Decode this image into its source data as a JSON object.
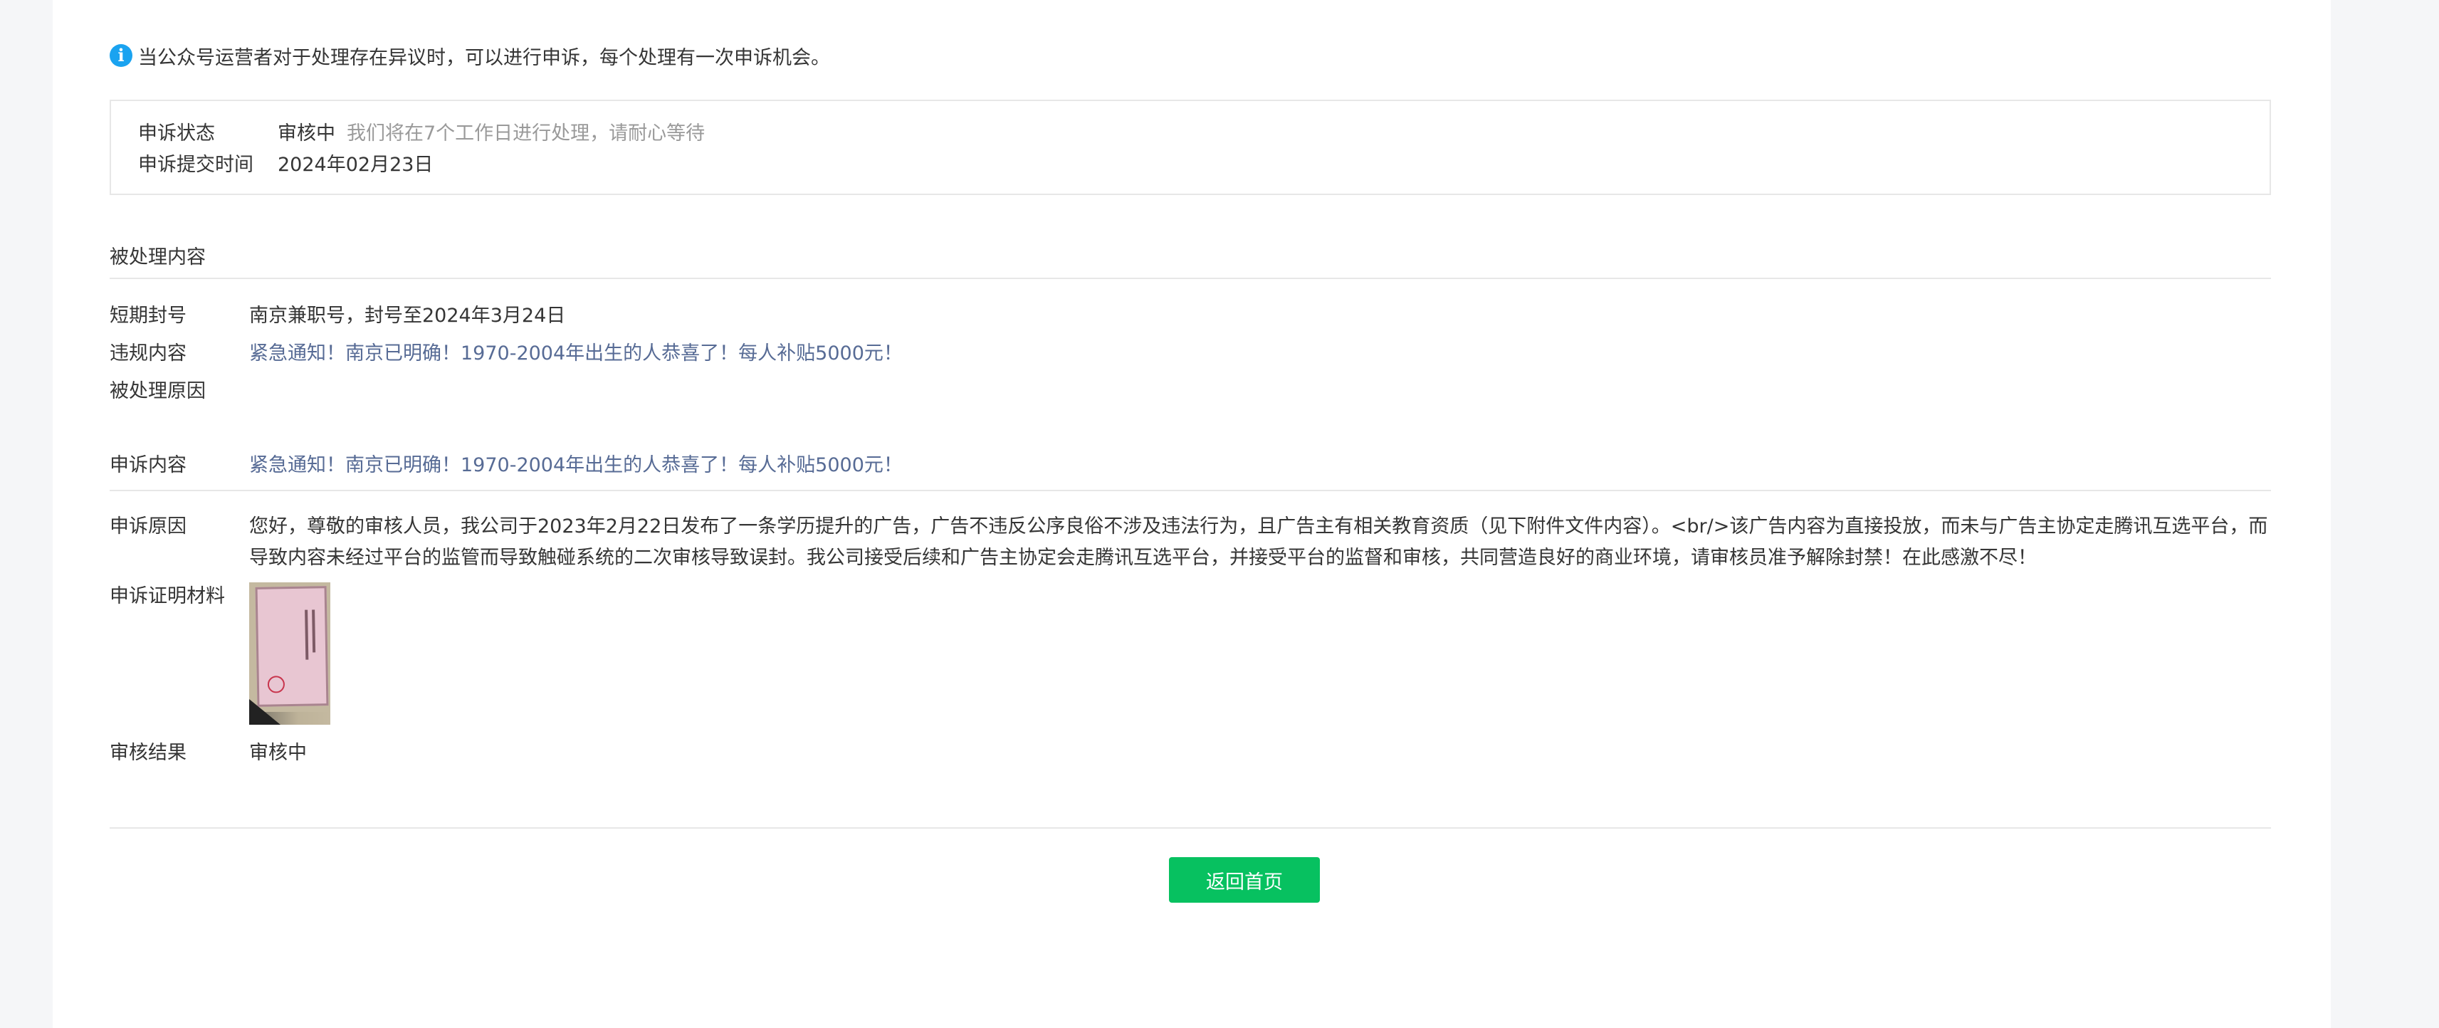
{
  "tip": {
    "icon": "info-icon",
    "icon_glyph": "i",
    "text": "当公众号运营者对于处理存在异议时，可以进行申诉，每个处理有一次申诉机会。"
  },
  "status": {
    "state_label": "申诉状态",
    "state_value": "审核中",
    "state_hint": "我们将在7个工作日进行处理，请耐心等待",
    "time_label": "申诉提交时间",
    "time_value": "2024年02月23日"
  },
  "processed": {
    "section_title": "被处理内容",
    "ban_label": "短期封号",
    "ban_value": "南京兼职号，封号至2024年3月24日",
    "violation_label": "违规内容",
    "violation_value": "紧急通知！南京已明确！1970-2004年出生的人恭喜了！每人补贴5000元！",
    "reason_label": "被处理原因",
    "reason_value": ""
  },
  "appeal": {
    "content_label": "申诉内容",
    "content_value": "紧急通知！南京已明确！1970-2004年出生的人恭喜了！每人补贴5000元！",
    "reason_label": "申诉原因",
    "reason_value": "您好，尊敬的审核人员，我公司于2023年2月22日发布了一条学历提升的广告，广告不违反公序良俗不涉及违法行为，且广告主有相关教育资质（见下附件文件内容）。<br/>该广告内容为直接投放，而未与广告主协定走腾讯互选平台，而导致内容未经过平台的监管而导致触碰系统的二次审核导致误封。我公司接受后续和广告主协定会走腾讯互选平台，并接受平台的监督和审核，共同营造良好的商业环境，请审核员准予解除封禁！在此感激不尽！",
    "proof_label": "申诉证明材料",
    "result_label": "审核结果",
    "result_value": "审核中"
  },
  "actions": {
    "back_label": "返回首页"
  },
  "colors": {
    "accent_green": "#07c160",
    "link_blue": "#576b95",
    "info_blue": "#1aa3f0",
    "hint_gray": "#9a9a9a"
  }
}
